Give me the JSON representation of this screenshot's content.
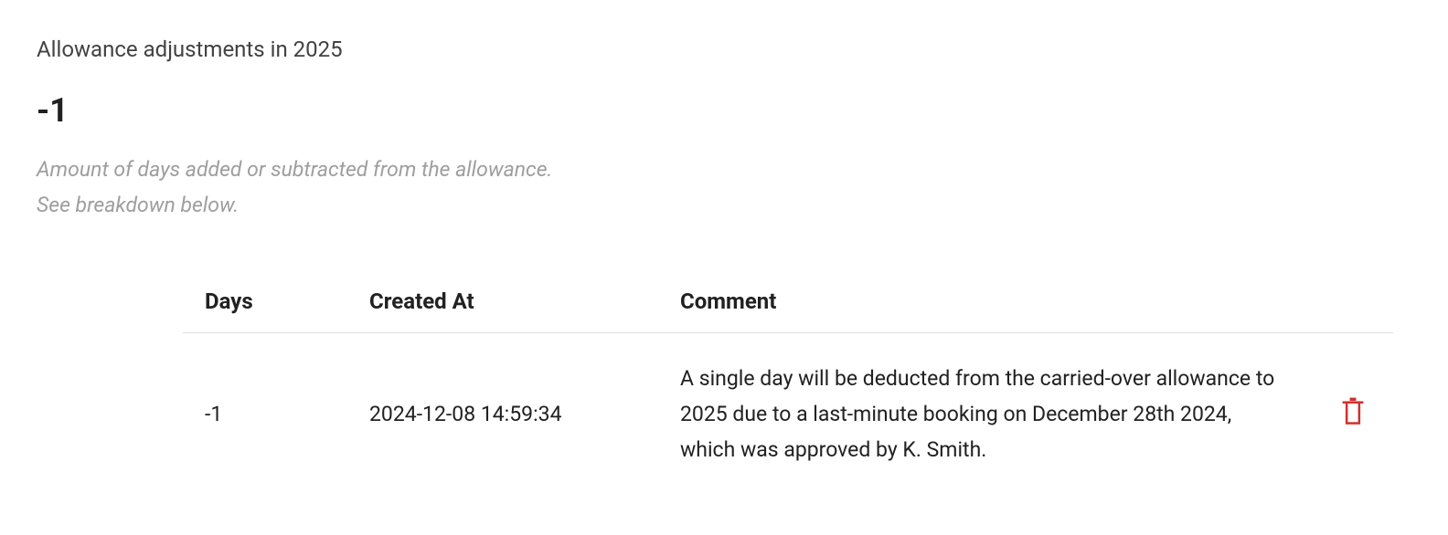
{
  "header": {
    "title": "Allowance adjustments in 2025",
    "total": "-1",
    "description_line1": "Amount of days added or subtracted from the allowance.",
    "description_line2": "See breakdown below."
  },
  "table": {
    "headers": {
      "days": "Days",
      "created_at": "Created At",
      "comment": "Comment"
    },
    "rows": [
      {
        "days": "-1",
        "created_at": "2024-12-08 14:59:34",
        "comment": "A single day will be deducted from the carried-over allowance to 2025 due to a last-minute booking on December 28th 2024, which was approved by K. Smith."
      }
    ]
  },
  "colors": {
    "trash": "#d32f2f"
  }
}
